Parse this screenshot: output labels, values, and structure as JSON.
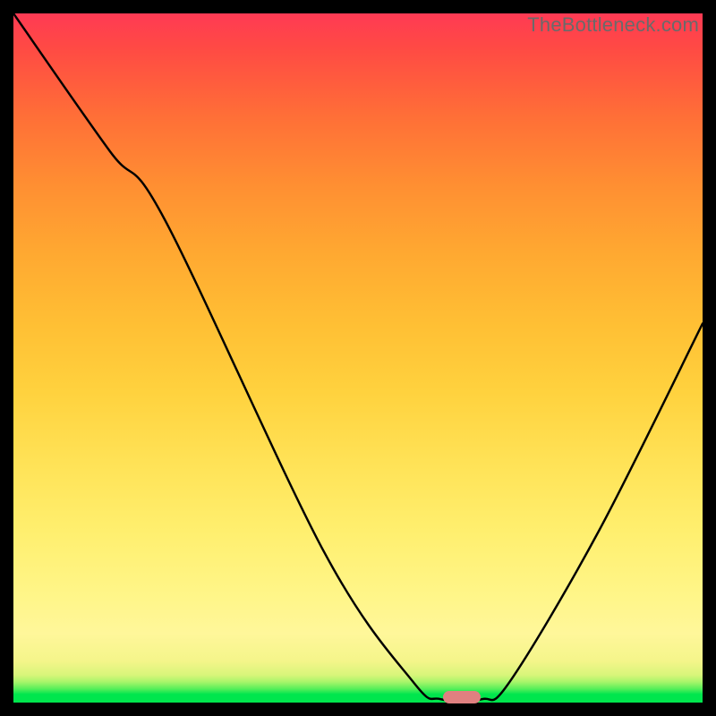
{
  "attribution": "TheBottleneck.com",
  "colors": {
    "frame": "#000000",
    "curve": "#000000",
    "marker": "#e08080"
  },
  "chart_data": {
    "type": "line",
    "title": "",
    "xlabel": "",
    "ylabel": "",
    "xlim": [
      0,
      100
    ],
    "ylim": [
      0,
      100
    ],
    "grid": false,
    "legend": false,
    "points": [
      {
        "x": 0,
        "y": 100
      },
      {
        "x": 14,
        "y": 80
      },
      {
        "x": 22,
        "y": 70
      },
      {
        "x": 45,
        "y": 22
      },
      {
        "x": 58,
        "y": 3
      },
      {
        "x": 62,
        "y": 0.5
      },
      {
        "x": 68,
        "y": 0.5
      },
      {
        "x": 72,
        "y": 3
      },
      {
        "x": 85,
        "y": 25
      },
      {
        "x": 100,
        "y": 55
      }
    ],
    "marker": {
      "x": 65,
      "y": 0.8
    },
    "gradient_stops": [
      {
        "pos": 0.0,
        "color": "#00e64d"
      },
      {
        "pos": 0.04,
        "color": "#d8f57a"
      },
      {
        "pos": 0.1,
        "color": "#fff79a"
      },
      {
        "pos": 0.45,
        "color": "#ffd23e"
      },
      {
        "pos": 0.75,
        "color": "#ff8f32"
      },
      {
        "pos": 1.0,
        "color": "#ff3a54"
      }
    ]
  }
}
